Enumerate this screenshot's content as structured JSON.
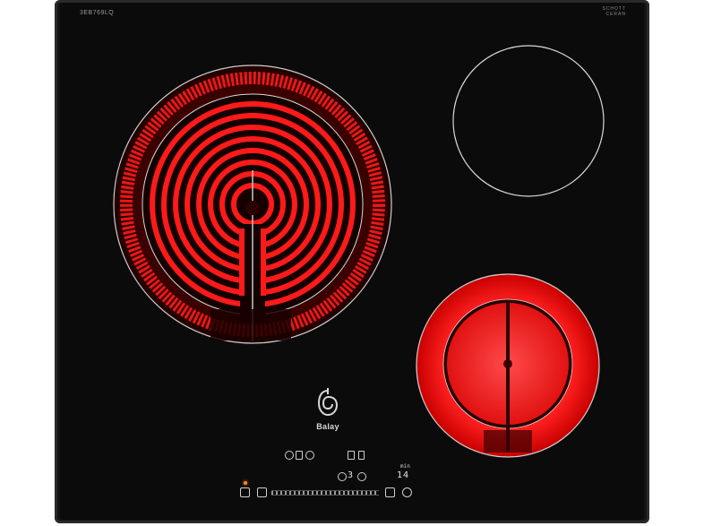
{
  "hob": {
    "model_code": "3EB769LQ",
    "glass_brand": [
      "SCHOTT",
      "CERAN"
    ],
    "glass_sub": "",
    "brand": "Balay",
    "timer_label": "min",
    "timer_value": "14",
    "power_value": "3"
  },
  "colors": {
    "glass": "#0b0b0b",
    "frame": "#2a2a2a",
    "heating_red": "#ff1a1a",
    "led": "#ff8a1a"
  },
  "zones": [
    {
      "name": "large-dual-zone",
      "state": "on"
    },
    {
      "name": "top-right-zone",
      "state": "off"
    },
    {
      "name": "small-dual-zone",
      "state": "on"
    }
  ]
}
